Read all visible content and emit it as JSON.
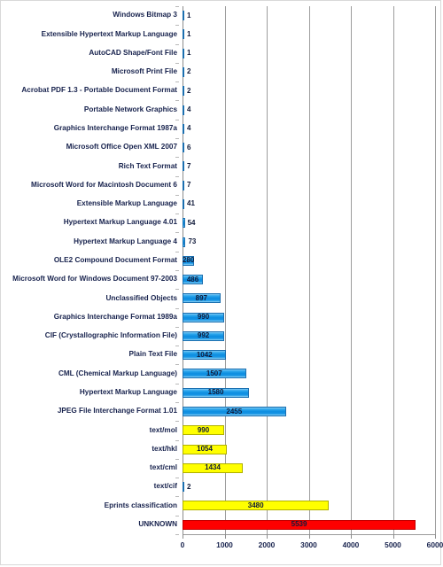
{
  "chart_data": {
    "type": "bar",
    "orientation": "horizontal",
    "title": "",
    "subtitle": "",
    "xlabel": "",
    "ylabel": "",
    "xlim": [
      0,
      6000
    ],
    "grid": true,
    "legend": "none",
    "xticks": [
      "0",
      "1000",
      "2000",
      "3000",
      "4000",
      "5000",
      "6000"
    ],
    "xtick_values": [
      0,
      1000,
      2000,
      3000,
      4000,
      5000,
      6000
    ],
    "categories": [
      "Windows Bitmap 3",
      "Extensible Hypertext Markup Language",
      "AutoCAD Shape/Font File",
      "Microsoft Print File",
      "Acrobat PDF 1.3 - Portable Document Format",
      "Portable Network Graphics",
      "Graphics Interchange Format 1987a",
      "Microsoft Office Open XML 2007",
      "Rich Text Format",
      "Microsoft Word for Macintosh Document 6",
      "Extensible Markup Language",
      "Hypertext Markup Language 4.01",
      "Hypertext Markup Language 4",
      "OLE2 Compound Document Format",
      "Microsoft Word for Windows Document 97-2003",
      "Unclassified Objects",
      "Graphics Interchange Format 1989a",
      "CIF (Crystallographic Information File)",
      "Plain Text File",
      "CML (Chemical Markup Language)",
      "Hypertext Markup Language",
      "JPEG File Interchange Format 1.01",
      "text/mol",
      "text/hkl",
      "text/cml",
      "text/cif",
      "Eprints classification",
      "UNKNOWN"
    ],
    "values": [
      1,
      1,
      1,
      2,
      2,
      4,
      4,
      6,
      7,
      7,
      41,
      54,
      73,
      280,
      486,
      897,
      990,
      992,
      1042,
      1507,
      1580,
      2455,
      990,
      1054,
      1434,
      2,
      3480,
      5539
    ],
    "colors": [
      "blue",
      "blue",
      "blue",
      "blue",
      "blue",
      "blue",
      "blue",
      "blue",
      "blue",
      "blue",
      "blue",
      "blue",
      "blue",
      "blue",
      "blue",
      "blue",
      "blue",
      "blue",
      "blue",
      "blue",
      "blue",
      "blue",
      "yellow",
      "yellow",
      "yellow",
      "blue",
      "yellow",
      "red"
    ],
    "value_label_position": [
      "outside",
      "outside",
      "outside",
      "outside",
      "outside",
      "outside",
      "outside",
      "outside",
      "outside",
      "outside",
      "outside",
      "outside",
      "outside",
      "inside",
      "inside",
      "inside",
      "inside",
      "inside",
      "inside",
      "inside",
      "inside",
      "inside",
      "inside",
      "inside",
      "inside",
      "outside",
      "inside",
      "inside"
    ],
    "palette": {
      "blue": "#0c8de0",
      "yellow": "#ffff00",
      "red": "#fe0000",
      "label_text": "#17224d",
      "gridline": "#9d9d9d",
      "background": "#ffffff"
    }
  }
}
